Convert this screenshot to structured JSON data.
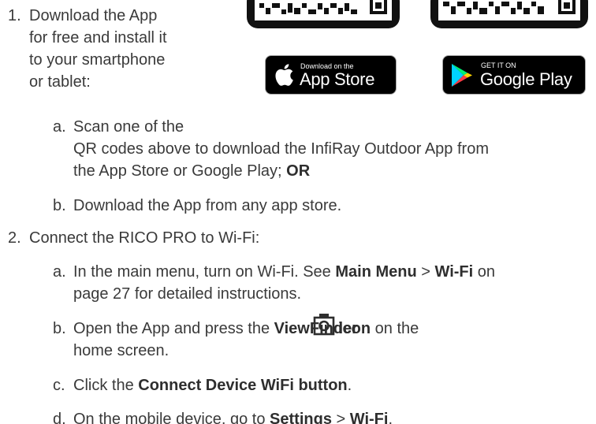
{
  "step1": {
    "number": "1.",
    "lines": [
      "Download the App",
      "for free and install it",
      "to your smartphone",
      "or tablet:"
    ],
    "sub_a": {
      "letter": "a.",
      "line1": "Scan one of the",
      "line2": "QR codes above to download the InfiRay Outdoor App from",
      "line3_prefix": "the App Store or Google Play; ",
      "line3_bold": "OR"
    },
    "sub_b": {
      "letter": "b.",
      "text": "Download the App from any app store."
    }
  },
  "badges": {
    "app_store": {
      "small": "Download on the",
      "big": "App Store",
      "icon": "apple-icon"
    },
    "google_play": {
      "small": "GET IT ON",
      "big": "Google Play",
      "icon": "play-triangle-icon"
    }
  },
  "step2": {
    "number": "2.",
    "text": "Connect the RICO PRO to Wi-Fi:",
    "sub_a": {
      "letter": "a.",
      "prefix": "In the main menu, turn on Wi-Fi. See ",
      "bold1": "Main Menu",
      "sep": " > ",
      "bold2": "Wi-Fi",
      "suffix": " on",
      "line2": "page 27 for detailed instructions."
    },
    "sub_b": {
      "letter": "b.",
      "prefix": "Open the App and press the ",
      "bold1": "ViewFinder",
      "icon": "camera-viewfinder-icon",
      "bold2": "icon",
      "suffix": " on the",
      "line2": "home screen."
    },
    "sub_c": {
      "letter": "c.",
      "prefix": "Click the ",
      "bold": "Connect Device WiFi button",
      "suffix": "."
    },
    "sub_d": {
      "letter": "d.",
      "prefix": "On the mobile device, go to ",
      "bold1": "Settings",
      "sep": " > ",
      "bold2": "Wi-Fi",
      "suffix": "."
    }
  },
  "colors": {
    "text": "#3a3a3a",
    "bold": "#2e2e2e",
    "badge_bg": "#000000",
    "badge_border": "#a6a6a6"
  }
}
